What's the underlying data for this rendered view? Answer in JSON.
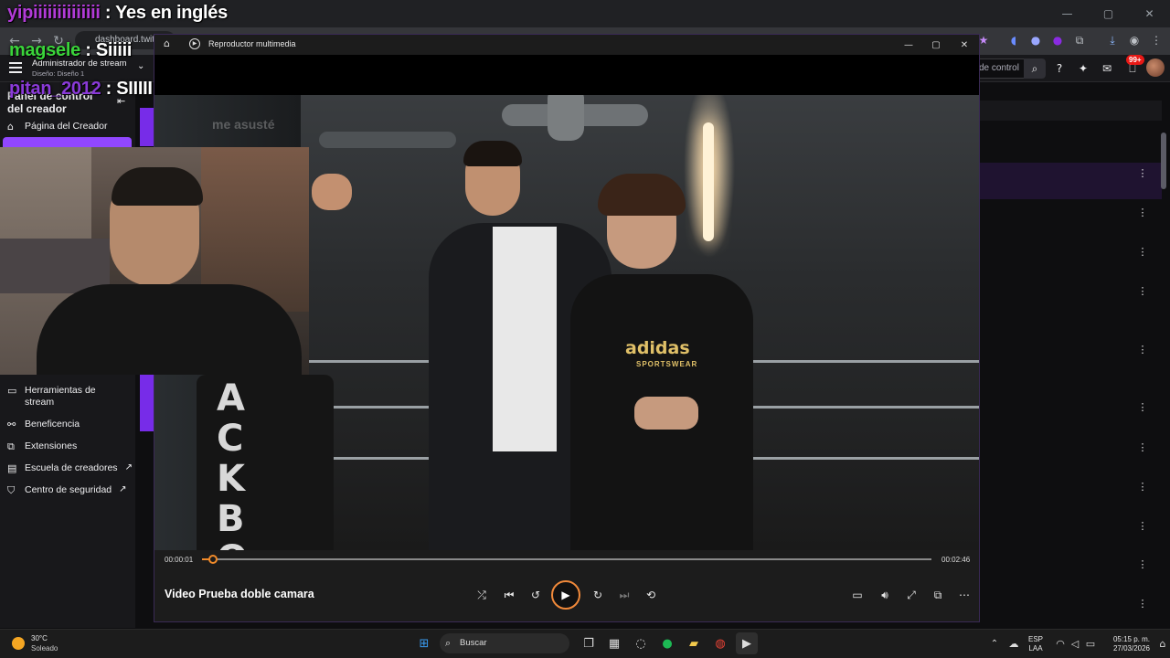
{
  "browser": {
    "url": "dashboard.twitch",
    "window_controls": [
      "—",
      "▢",
      "✕"
    ]
  },
  "twitch": {
    "search_value": "de control",
    "notifications_badge": "99+",
    "sidebar": {
      "role": "Administrador de stream",
      "layout": "Diseño: Diseño 1",
      "title": "Panel de control del creador",
      "creator_page": "Página del Creador",
      "items": [
        {
          "label": "Herramientas de stream",
          "icon": "camera-icon"
        },
        {
          "label": "Beneficencia",
          "icon": "dna-icon"
        },
        {
          "label": "Extensiones",
          "icon": "puzzle-icon"
        },
        {
          "label": "Escuela de creadores",
          "icon": "book-icon"
        },
        {
          "label": "Centro de seguridad",
          "icon": "shield-icon"
        }
      ]
    },
    "background_chat": "me asusté"
  },
  "overlay_chat": [
    {
      "user": "yipiiiiiiiiiiiiii",
      "sep": " : ",
      "msg": "Yes en inglés",
      "color": "#b23bd8"
    },
    {
      "user": "magsele",
      "sep": " : ",
      "msg": "Siiiii",
      "color": "#3ad43a"
    },
    {
      "user": "pitan_2012",
      "sep": " : ",
      "msg": "SIIIII",
      "color": "#8a3ad8"
    }
  ],
  "player": {
    "app_title": "Reproductor multimedia",
    "video_title": "Video Prueba doble camara",
    "elapsed": "00:00:01",
    "duration": "00:02:46",
    "progress": 0.01,
    "bag_text": "ACKBO",
    "shirt_brand": "adidas",
    "shirt_sub": "SPORTSWEAR"
  },
  "taskbar": {
    "weather_temp": "30°C",
    "weather_desc": "Soleado",
    "search_placeholder": "Buscar",
    "lang": "ESP",
    "lang_sub": "LAA",
    "time": "05:15 p. m.",
    "date": "27/03/2026"
  }
}
